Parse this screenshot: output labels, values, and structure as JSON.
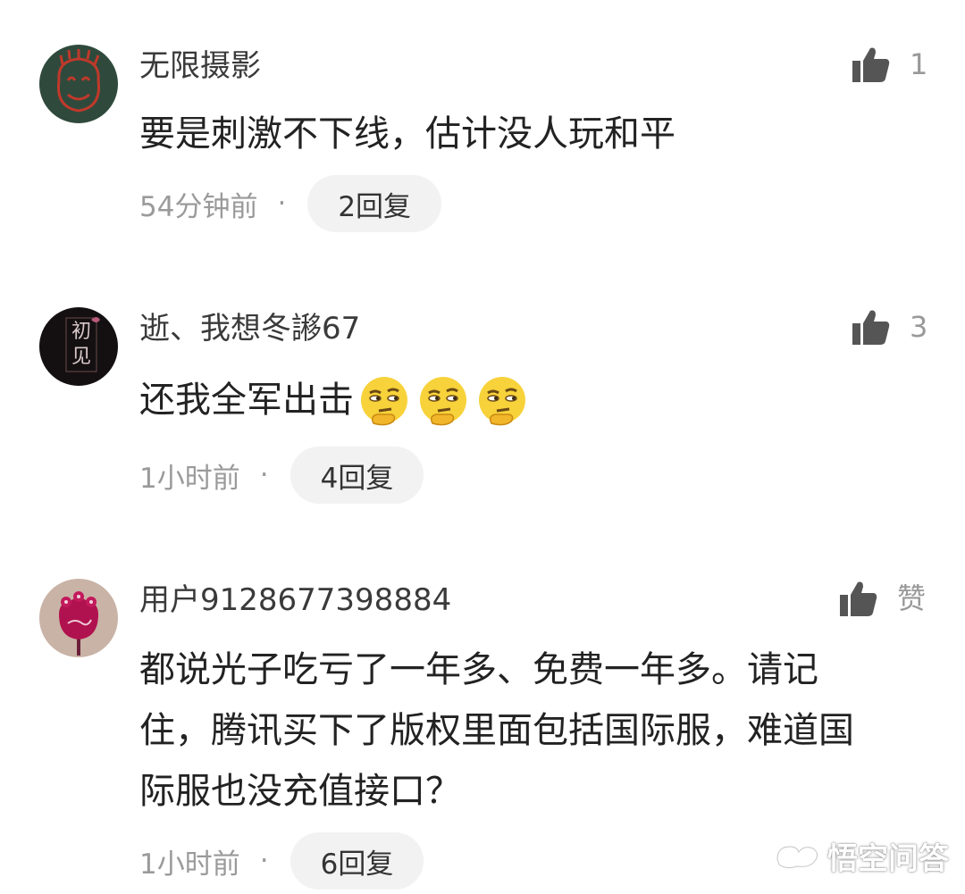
{
  "comments": [
    {
      "username": "无限摄影",
      "avatar": "avatar-doodle-face",
      "like_count": "1",
      "text": "要是刺激不下线，估计没人玩和平",
      "emojis": [],
      "time": "54分钟前",
      "separator": "·",
      "reply_label": "2回复"
    },
    {
      "username": "逝、我想冬謻67",
      "avatar": "avatar-chujian-dark",
      "avatar_text": "初见",
      "like_count": "3",
      "text": "还我全军出击",
      "emojis": [
        "thinking-face-emoji",
        "thinking-face-emoji",
        "thinking-face-emoji"
      ],
      "time": "1小时前",
      "separator": "·",
      "reply_label": "4回复"
    },
    {
      "username": "用户9128677398884",
      "avatar": "avatar-pink-flower",
      "like_count": "赞",
      "text_lines": [
        "都说光子吃亏了一年多、免费一年多。请记",
        "住，腾讯买下了版权里面包括国际服，难道国",
        "际服也没充值接口？"
      ],
      "emojis": [],
      "time": "1小时前",
      "separator": "·",
      "reply_label": "6回复"
    }
  ],
  "watermark": {
    "text": "悟空问答",
    "icon": "wukong-logo-icon"
  },
  "colors": {
    "reply_bg": "#f2f2f2",
    "meta_gray": "#9a9a9a",
    "icon_gray": "#555555"
  }
}
